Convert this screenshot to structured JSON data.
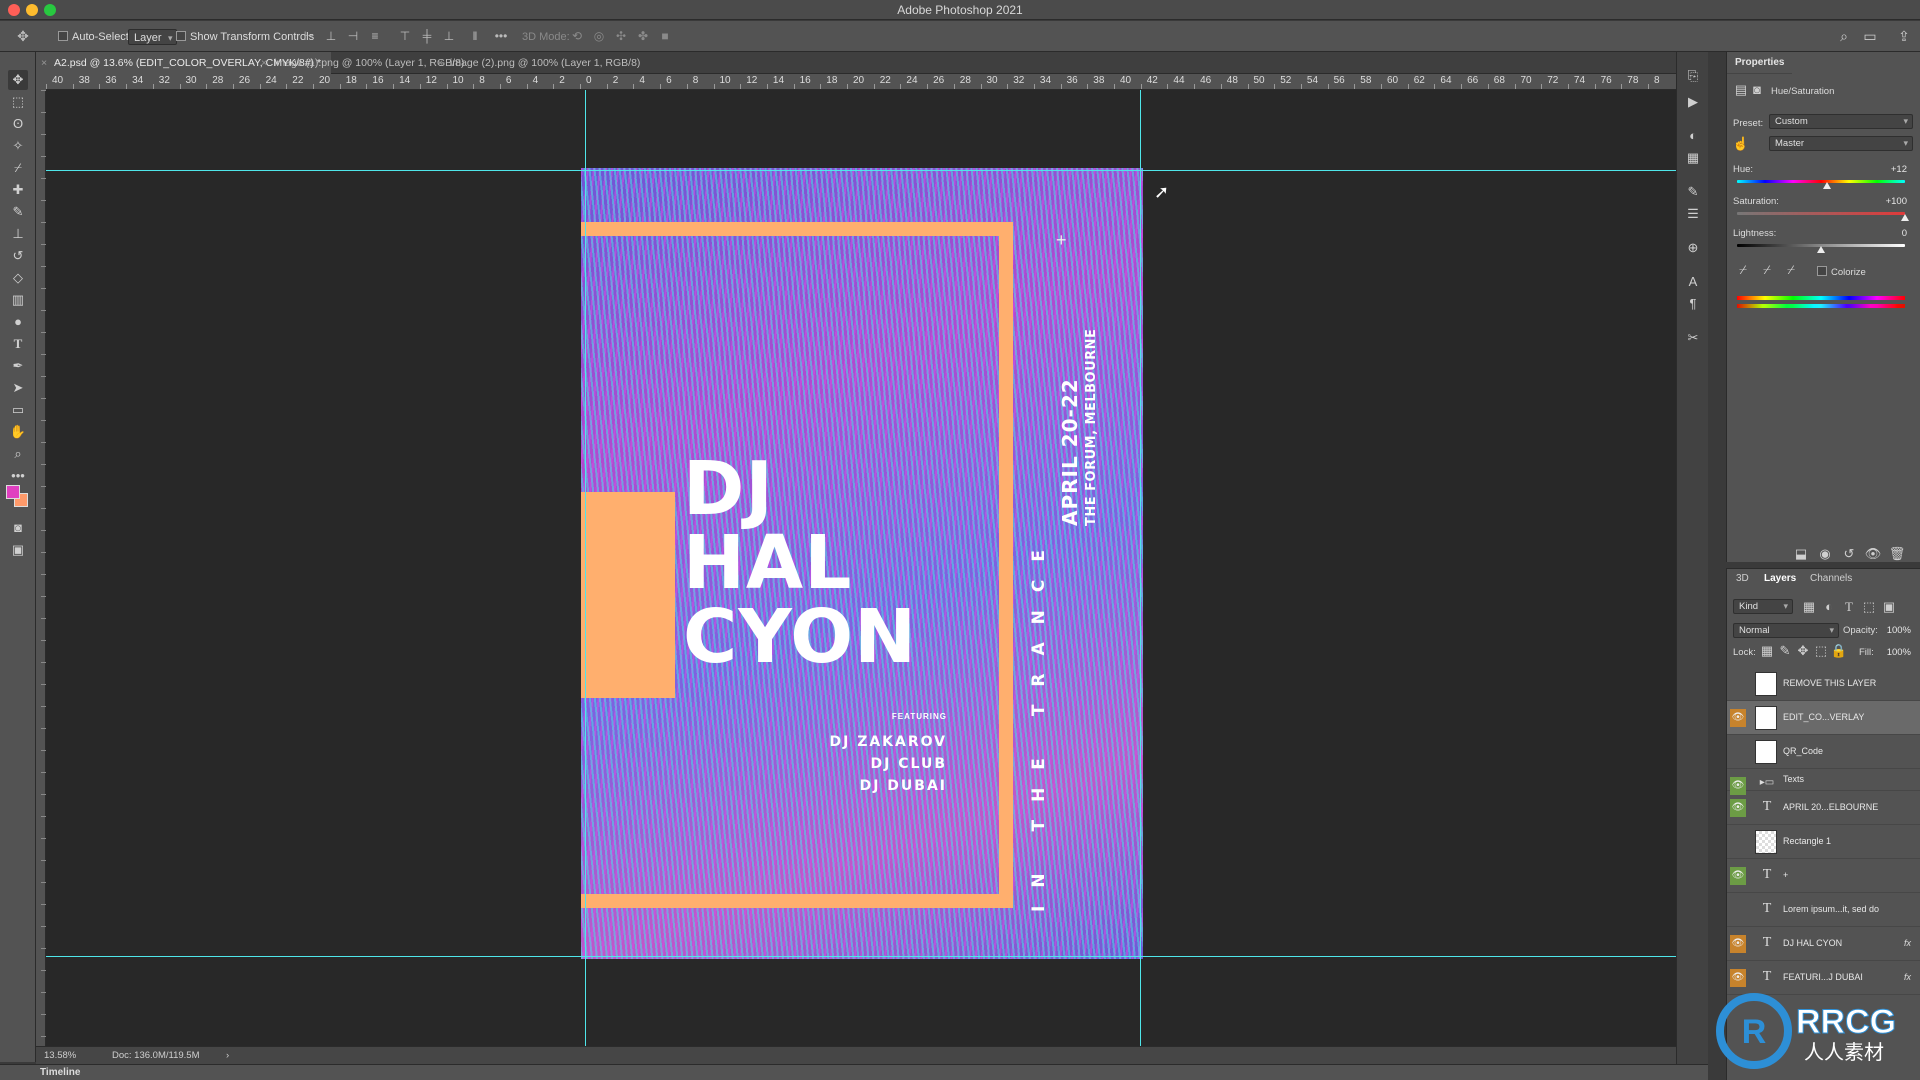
{
  "app": {
    "title": "Adobe Photoshop 2021"
  },
  "options_bar": {
    "auto_select_label": "Auto-Select:",
    "auto_select_value": "Layer",
    "show_transform_label": "Show Transform Controls",
    "mode_3d_label": "3D Mode:"
  },
  "tabs": [
    {
      "label": "A2.psd @ 13.6% (EDIT_COLOR_OVERLAY, CMYK/8#) *",
      "active": true
    },
    {
      "label": "image (1).png @ 100% (Layer 1, RGB/8)",
      "active": false
    },
    {
      "label": "image (2).png @ 100% (Layer 1, RGB/8)",
      "active": false
    }
  ],
  "ruler_top_labels": [
    "40",
    "38",
    "36",
    "34",
    "32",
    "30",
    "28",
    "26",
    "24",
    "22",
    "20",
    "18",
    "16",
    "14",
    "12",
    "10",
    "8",
    "6",
    "4",
    "2",
    "0",
    "2",
    "4",
    "6",
    "8",
    "10",
    "12",
    "14",
    "16",
    "18",
    "20",
    "22",
    "24",
    "26",
    "28",
    "30",
    "32",
    "34",
    "36",
    "38",
    "40",
    "42",
    "44",
    "46",
    "48",
    "50",
    "52",
    "54",
    "56",
    "58",
    "60",
    "62",
    "64",
    "66",
    "68",
    "70",
    "72",
    "74",
    "76",
    "78",
    "8"
  ],
  "poster": {
    "headline": [
      "DJ",
      "HAL",
      "CYON"
    ],
    "featuring": "FEATURING",
    "djs": [
      "DJ ZAKAROV",
      "DJ CLUB",
      "DJ DUBAI"
    ],
    "date_line": "APRIL 20-22",
    "venue_line": "THE FORUM, MELBOURNE",
    "tagline": "IN THE TRANCE",
    "colors": {
      "accent": "#ffaf6e",
      "text": "#ffffff",
      "guide": "#4fe6ea"
    }
  },
  "status": {
    "zoom": "13.58%",
    "doc": "Doc: 136.0M/119.5M",
    "timeline": "Timeline"
  },
  "properties": {
    "tab": "Properties",
    "adjustment": "Hue/Saturation",
    "preset_label": "Preset:",
    "preset_value": "Custom",
    "channel_value": "Master",
    "hue_label": "Hue:",
    "hue_value": "+12",
    "saturation_label": "Saturation:",
    "saturation_value": "+100",
    "lightness_label": "Lightness:",
    "lightness_value": "0",
    "colorize_label": "Colorize",
    "hue_level": 12,
    "saturation_level": 100,
    "lightness_level": 0
  },
  "layers_panel": {
    "tabs": [
      "3D",
      "Layers",
      "Channels"
    ],
    "kind_label": "Kind",
    "blend_mode": "Normal",
    "opacity_label": "Opacity:",
    "opacity_value": "100%",
    "lock_label": "Lock:",
    "fill_label": "Fill:",
    "fill_value": "100%",
    "layers": [
      {
        "name": "REMOVE THIS LAYER",
        "type": "pixel",
        "visible": false
      },
      {
        "name": "EDIT_CO...VERLAY",
        "type": "adjustment",
        "visible": true,
        "selected": true
      },
      {
        "name": "QR_Code",
        "type": "smart",
        "visible": false
      },
      {
        "name": "Texts",
        "type": "group",
        "visible": true
      },
      {
        "name": "APRIL 20...ELBOURNE",
        "type": "text",
        "visible": true
      },
      {
        "name": "Rectangle 1",
        "type": "shape",
        "visible": false
      },
      {
        "name": "+",
        "type": "text",
        "visible": true
      },
      {
        "name": "Lorem ipsum...it, sed do",
        "type": "text",
        "visible": false
      },
      {
        "name": "DJ HAL CYON",
        "type": "text",
        "visible": true,
        "fx": "fx"
      },
      {
        "name": "FEATURI...J DUBAI",
        "type": "text",
        "visible": true,
        "fx": "fx"
      }
    ]
  },
  "watermark": {
    "logo_text": "RRCG",
    "logo_sub": "人人素材"
  }
}
